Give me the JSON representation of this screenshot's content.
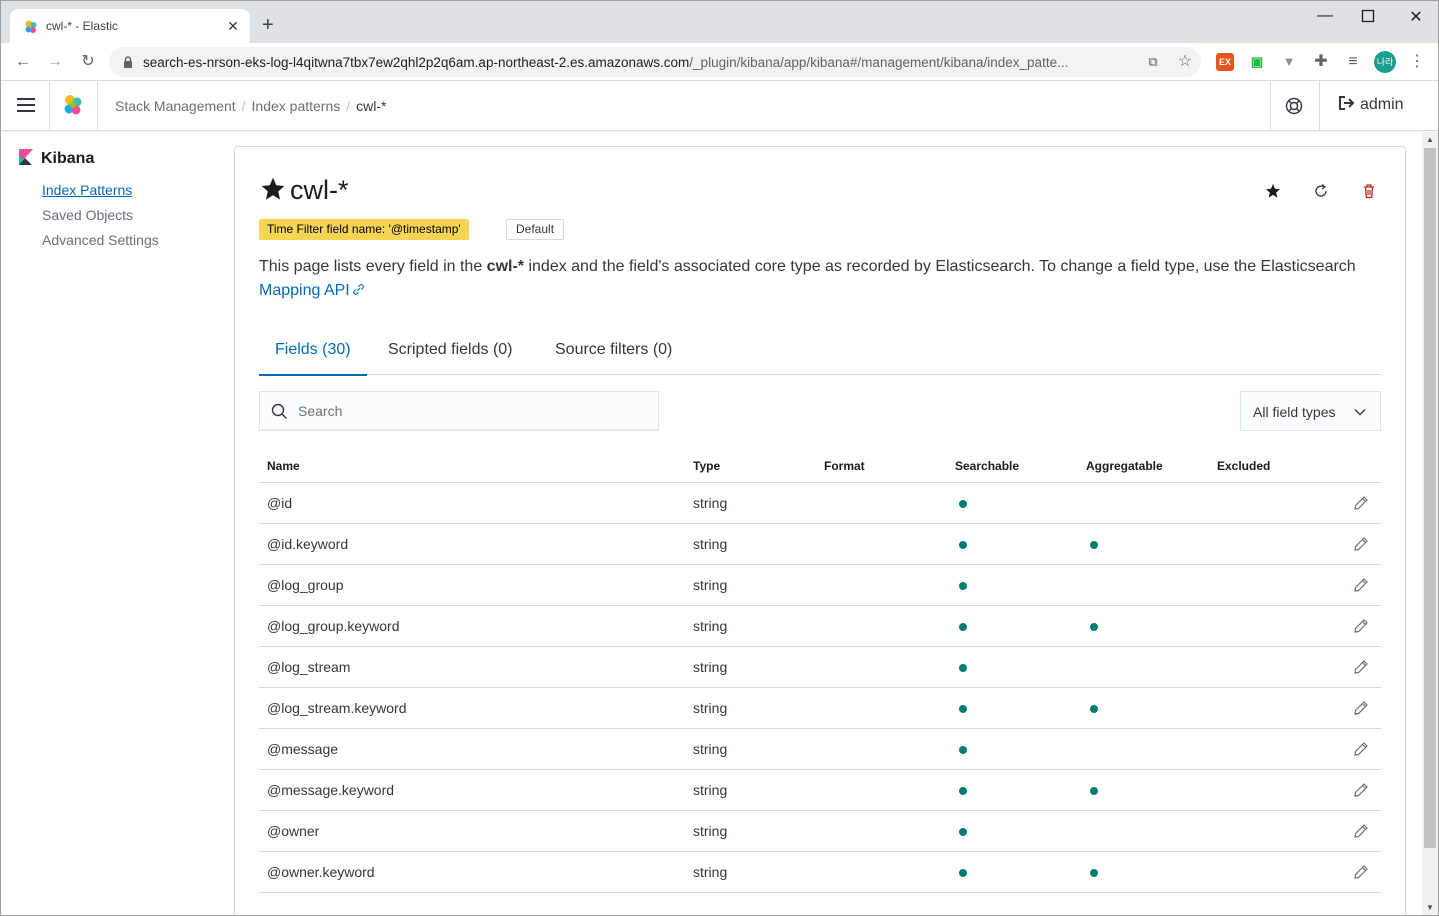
{
  "browser": {
    "tab_title": "cwl-* - Elastic",
    "new_tab_label": "+",
    "url_host": "search-es-nrson-eks-log-l4qitwna7tbx7ew2qhl2p2q6am.ap-northeast-2.es.amazonaws.com",
    "url_path": "/_plugin/kibana/app/kibana#/management/kibana/index_patte...",
    "extensions": [
      {
        "name": "ex-extension-icon",
        "label": "EX",
        "color": "#e8541e"
      },
      {
        "name": "screen-extension-icon",
        "label": "▣",
        "color": "#1fba3a"
      },
      {
        "name": "vue-extension-icon",
        "label": "▼",
        "color": "#8a8f95"
      }
    ],
    "profile_initials": "나라",
    "accent_color": "#1a9e8f"
  },
  "header": {
    "breadcrumbs": [
      "Stack Management",
      "Index patterns"
    ],
    "breadcrumb_current": "cwl-*",
    "user": "admin"
  },
  "sidebar": {
    "app_title": "Kibana",
    "items": [
      {
        "label": "Index Patterns",
        "active": true
      },
      {
        "label": "Saved Objects",
        "active": false
      },
      {
        "label": "Advanced Settings",
        "active": false
      }
    ]
  },
  "page": {
    "title": "cwl-*",
    "time_filter_badge": "Time Filter field name: '@timestamp'",
    "default_badge": "Default",
    "description_prefix": "This page lists every field in the ",
    "description_index": "cwl-*",
    "description_suffix": " index and the field's associated core type as recorded by Elasticsearch. To change a field type, use the Elasticsearch ",
    "description_link": "Mapping API",
    "tabs": [
      {
        "label": "Fields (30)",
        "selected": true
      },
      {
        "label": "Scripted fields (0)",
        "selected": false
      },
      {
        "label": "Source filters (0)",
        "selected": false
      }
    ],
    "search_placeholder": "Search",
    "filter_label": "All field types"
  },
  "table": {
    "columns": [
      "Name",
      "Type",
      "Format",
      "Searchable",
      "Aggregatable",
      "Excluded"
    ],
    "rows": [
      {
        "name": "@id",
        "type": "string",
        "format": "",
        "searchable": true,
        "aggregatable": false,
        "excluded": false
      },
      {
        "name": "@id.keyword",
        "type": "string",
        "format": "",
        "searchable": true,
        "aggregatable": true,
        "excluded": false
      },
      {
        "name": "@log_group",
        "type": "string",
        "format": "",
        "searchable": true,
        "aggregatable": false,
        "excluded": false
      },
      {
        "name": "@log_group.keyword",
        "type": "string",
        "format": "",
        "searchable": true,
        "aggregatable": true,
        "excluded": false
      },
      {
        "name": "@log_stream",
        "type": "string",
        "format": "",
        "searchable": true,
        "aggregatable": false,
        "excluded": false
      },
      {
        "name": "@log_stream.keyword",
        "type": "string",
        "format": "",
        "searchable": true,
        "aggregatable": true,
        "excluded": false
      },
      {
        "name": "@message",
        "type": "string",
        "format": "",
        "searchable": true,
        "aggregatable": false,
        "excluded": false
      },
      {
        "name": "@message.keyword",
        "type": "string",
        "format": "",
        "searchable": true,
        "aggregatable": true,
        "excluded": false
      },
      {
        "name": "@owner",
        "type": "string",
        "format": "",
        "searchable": true,
        "aggregatable": false,
        "excluded": false
      },
      {
        "name": "@owner.keyword",
        "type": "string",
        "format": "",
        "searchable": true,
        "aggregatable": true,
        "excluded": false
      }
    ]
  },
  "colors": {
    "link": "#006bb4",
    "dot": "#017d73",
    "time_badge": "#f5d553",
    "delete": "#bd271e"
  }
}
